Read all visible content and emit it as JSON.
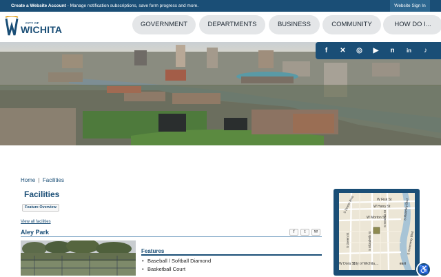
{
  "topbar": {
    "message_link": "Create a Website Account",
    "message_text": " - Manage notification subscriptions, save form progress and more.",
    "sign_in": "Website Sign In"
  },
  "logo": {
    "city": "CITY OF",
    "name": "WICHITA"
  },
  "nav": [
    {
      "label": "GOVERNMENT"
    },
    {
      "label": "DEPARTMENTS"
    },
    {
      "label": "BUSINESS"
    },
    {
      "label": "COMMUNITY"
    },
    {
      "label": "HOW DO I..."
    }
  ],
  "social": [
    {
      "icon": "facebook-icon",
      "glyph": "f"
    },
    {
      "icon": "x-icon",
      "glyph": "✕"
    },
    {
      "icon": "instagram-icon",
      "glyph": "◎"
    },
    {
      "icon": "youtube-icon",
      "glyph": "▶"
    },
    {
      "icon": "nextdoor-icon",
      "glyph": "n"
    },
    {
      "icon": "linkedin-icon",
      "glyph": "in"
    },
    {
      "icon": "tiktok-icon",
      "glyph": "♪"
    }
  ],
  "breadcrumb": {
    "home": "Home",
    "separator": "|",
    "current": "Facilities"
  },
  "page": {
    "title": "Facilities",
    "feature_overview": "Feature Overview",
    "view_all": "View all facilities",
    "park_name": "Aley Park"
  },
  "share": [
    {
      "icon": "facebook-share-icon",
      "glyph": "f"
    },
    {
      "icon": "twitter-share-icon",
      "glyph": "t"
    },
    {
      "icon": "email-share-icon",
      "glyph": "✉"
    }
  ],
  "features": {
    "heading": "Features",
    "items": [
      "Baseball / Softball Diamond",
      "Basketball Court"
    ]
  },
  "map": {
    "streets": [
      "W Fisk St",
      "W Harry St",
      "W Morton St",
      "S Greenway Blvd",
      "S Elizabeth St",
      "S Seneca St",
      "S Green St",
      "S Mckinley Blvd",
      "S Dexter Blvd",
      "W Dora St"
    ],
    "attribution": "City of Wichita,...",
    "esri": "esri"
  },
  "colors": {
    "brand": "#1a4e76",
    "nav_bg": "#e4e6e8"
  }
}
